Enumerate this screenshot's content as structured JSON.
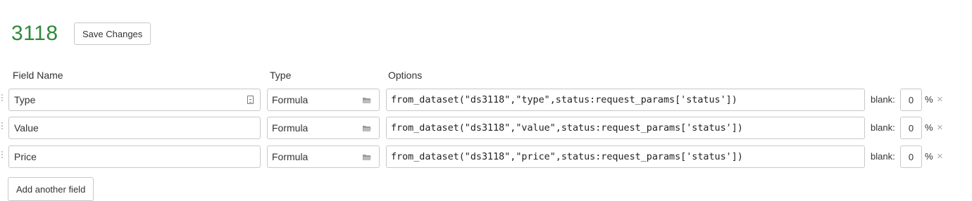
{
  "header": {
    "title": "3118",
    "save_label": "Save Changes"
  },
  "columns": {
    "field_name": "Field Name",
    "type": "Type",
    "options": "Options"
  },
  "rows": [
    {
      "name": "Type",
      "type": "Formula",
      "options": "from_dataset(\"ds3118\",\"type\",status:request_params['status'])",
      "blank_label": "blank:",
      "blank_value": "0",
      "percent": "%"
    },
    {
      "name": "Value",
      "type": "Formula",
      "options": "from_dataset(\"ds3118\",\"value\",status:request_params['status'])",
      "blank_label": "blank:",
      "blank_value": "0",
      "percent": "%"
    },
    {
      "name": "Price",
      "type": "Formula",
      "options": "from_dataset(\"ds3118\",\"price\",status:request_params['status'])",
      "blank_label": "blank:",
      "blank_value": "0",
      "percent": "%"
    }
  ],
  "footer": {
    "add_label": "Add another field"
  },
  "icons": {
    "remove": "×"
  },
  "colors": {
    "title": "#2e8b3a",
    "border": "#c8c8c8"
  }
}
